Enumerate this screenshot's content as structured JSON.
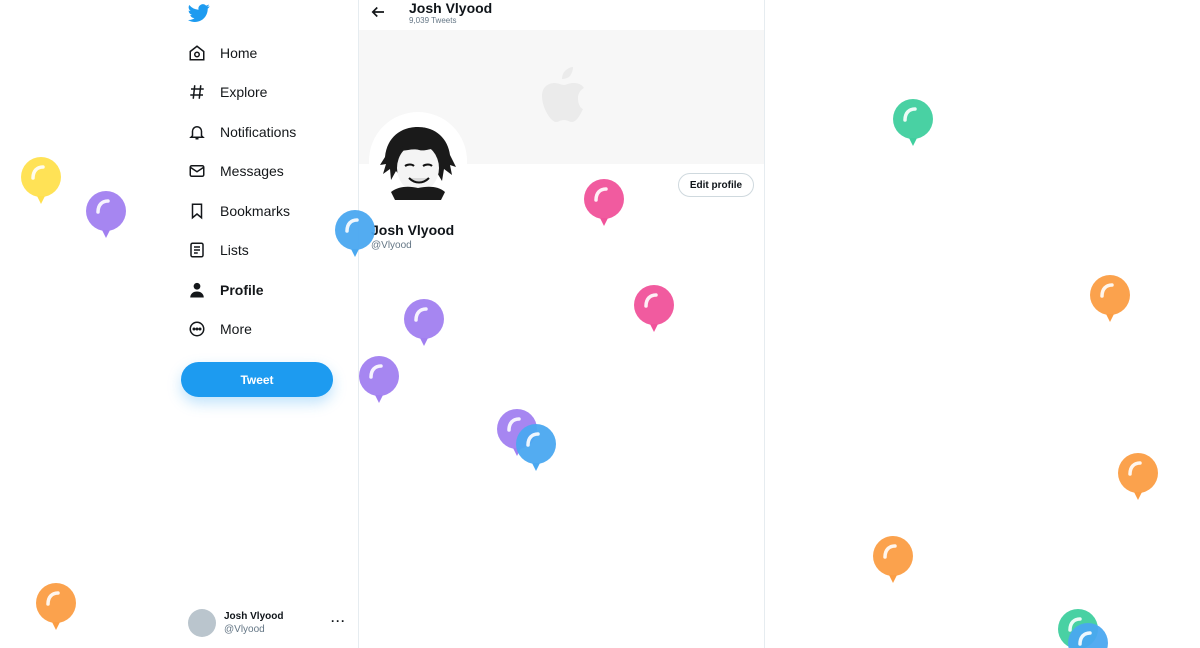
{
  "sidebar": {
    "logo_icon": "twitter-bird-icon",
    "items": [
      {
        "label": "Home",
        "icon": "home-icon"
      },
      {
        "label": "Explore",
        "icon": "hashtag-icon"
      },
      {
        "label": "Notifications",
        "icon": "bell-icon"
      },
      {
        "label": "Messages",
        "icon": "envelope-icon"
      },
      {
        "label": "Bookmarks",
        "icon": "bookmark-icon"
      },
      {
        "label": "Lists",
        "icon": "list-icon"
      },
      {
        "label": "Profile",
        "icon": "person-icon",
        "active": true
      },
      {
        "label": "More",
        "icon": "more-circle-icon"
      }
    ],
    "tweet_label": "Tweet",
    "account": {
      "name": "Josh Vlyood",
      "handle": "@Vlyood",
      "menu": "···"
    }
  },
  "header": {
    "title": "Josh Vlyood",
    "subtitle": "9,039 Tweets",
    "back_icon": "arrow-left-icon"
  },
  "profile": {
    "banner_icon": "apple-logo-icon",
    "name": "Josh Vlyood",
    "handle": "@Vlyood",
    "edit_label": "Edit profile"
  },
  "colors": {
    "accent": "#1d9bf0",
    "balloon_yellow": "#ffe04d",
    "balloon_purple": "#a17ff0",
    "balloon_blue": "#4aa8f0",
    "balloon_pink": "#f0529a",
    "balloon_green": "#3fcf9e",
    "balloon_orange": "#fb9d43"
  }
}
